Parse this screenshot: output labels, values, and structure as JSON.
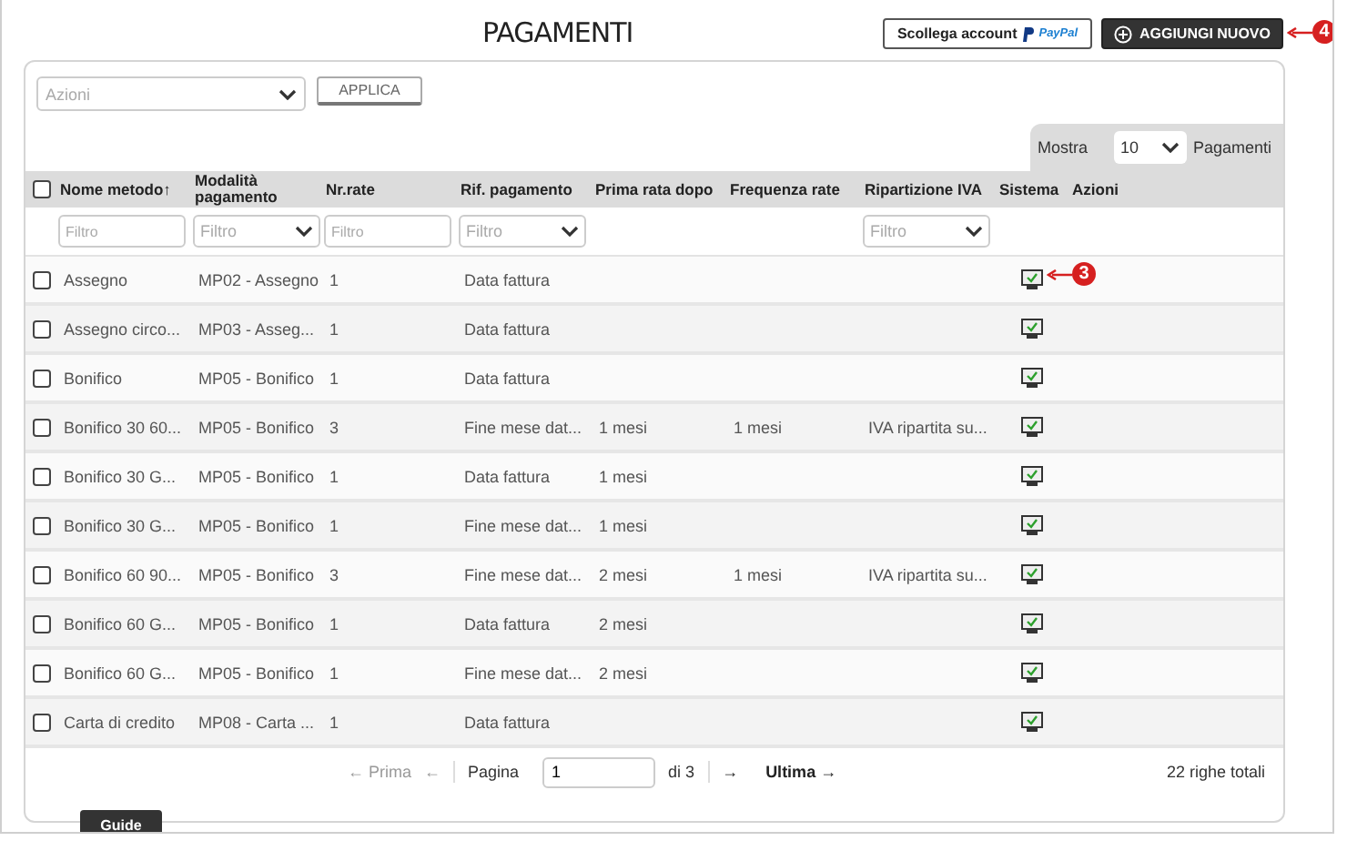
{
  "title": "PAGAMENTI",
  "header_buttons": {
    "paypal": {
      "label": "Scollega account",
      "logo": "PayPal"
    },
    "add": {
      "label": "AGGIUNGI NUOVO",
      "callout": "4"
    }
  },
  "actions": {
    "placeholder": "Azioni",
    "apply": "APPLICA"
  },
  "page_size": {
    "label": "Mostra",
    "value": "10",
    "suffix": "Pagamenti"
  },
  "select_all": {
    "checked": false
  },
  "columns": [
    {
      "label": "Nome metodo",
      "sort_indicator": "↑",
      "filter": {
        "kind": "text",
        "placeholder": "Filtro"
      }
    },
    {
      "label": "Modalità pagamento",
      "filter": {
        "kind": "select",
        "placeholder": "Filtro"
      }
    },
    {
      "label": "Nr.rate",
      "filter": {
        "kind": "text",
        "placeholder": "Filtro"
      }
    },
    {
      "label": "Rif. pagamento",
      "filter": {
        "kind": "select",
        "placeholder": "Filtro"
      }
    },
    {
      "label": "Prima rata dopo"
    },
    {
      "label": "Frequenza rate"
    },
    {
      "label": "Ripartizione IVA",
      "filter": {
        "kind": "select",
        "placeholder": "Filtro"
      }
    },
    {
      "label": "Sistema"
    },
    {
      "label": "Azioni"
    }
  ],
  "rows": [
    {
      "checked": false,
      "cells": [
        "Assegno",
        "MP02 - Assegno",
        "1",
        "Data fattura",
        null,
        null,
        null
      ],
      "system": true,
      "callout": "3"
    },
    {
      "checked": false,
      "cells": [
        "Assegno circo...",
        "MP03 - Asseg...",
        "1",
        "Data fattura",
        null,
        null,
        null
      ],
      "system": true
    },
    {
      "checked": false,
      "cells": [
        "Bonifico",
        "MP05 - Bonifico",
        "1",
        "Data fattura",
        null,
        null,
        null
      ],
      "system": true
    },
    {
      "checked": false,
      "cells": [
        "Bonifico 30 60...",
        "MP05 - Bonifico",
        "3",
        "Fine mese dat...",
        "1 mesi",
        "1 mesi",
        "IVA ripartita su..."
      ],
      "system": true
    },
    {
      "checked": false,
      "cells": [
        "Bonifico 30 G...",
        "MP05 - Bonifico",
        "1",
        "Data fattura",
        "1 mesi",
        null,
        null
      ],
      "system": true
    },
    {
      "checked": false,
      "cells": [
        "Bonifico 30 G...",
        "MP05 - Bonifico",
        "1",
        "Fine mese dat...",
        "1 mesi",
        null,
        null
      ],
      "system": true
    },
    {
      "checked": false,
      "cells": [
        "Bonifico 60 90...",
        "MP05 - Bonifico",
        "3",
        "Fine mese dat...",
        "2 mesi",
        "1 mesi",
        "IVA ripartita su..."
      ],
      "system": true
    },
    {
      "checked": false,
      "cells": [
        "Bonifico 60 G...",
        "MP05 - Bonifico",
        "1",
        "Data fattura",
        "2 mesi",
        null,
        null
      ],
      "system": true
    },
    {
      "checked": false,
      "cells": [
        "Bonifico 60 G...",
        "MP05 - Bonifico",
        "1",
        "Fine mese dat...",
        "2 mesi",
        null,
        null
      ],
      "system": true
    },
    {
      "checked": false,
      "cells": [
        "Carta di credito",
        "MP08 - Carta ...",
        "1",
        "Data fattura",
        null,
        null,
        null
      ],
      "system": true
    }
  ],
  "pagination": {
    "first": {
      "label": "← Prima",
      "disabled": true
    },
    "prev": {
      "label": "←",
      "disabled": true
    },
    "page_label": "Pagina",
    "page": "1",
    "of": "di 3",
    "next": {
      "label": "→",
      "disabled": false
    },
    "last": {
      "label": "Ultima →",
      "disabled": false
    },
    "total": "22 righe totali"
  },
  "guide_tab": "Guide"
}
